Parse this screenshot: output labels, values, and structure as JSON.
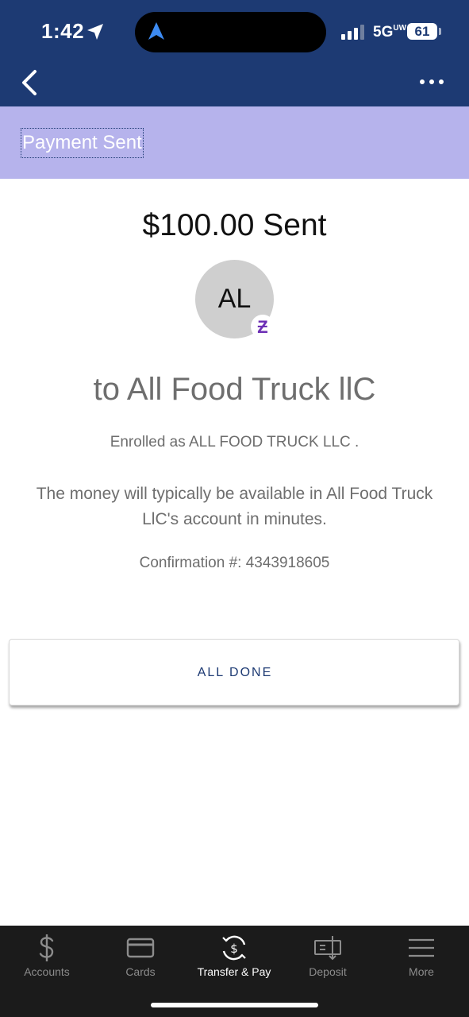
{
  "status_bar": {
    "time": "1:42",
    "network": "5G",
    "network_sub": "UW",
    "battery": "61"
  },
  "header": {
    "title": "Payment Sent"
  },
  "payment": {
    "amount_text": "$100.00 Sent",
    "avatar_initials": "AL",
    "zelle_glyph": "Ƶ",
    "recipient_line": "to All Food Truck llC",
    "enrolled_text": "Enrolled as ALL FOOD TRUCK LLC .",
    "availability_text": "The money will typically be available in All Food Truck LlC's account in minutes.",
    "confirmation_text": "Confirmation #: 4343918605"
  },
  "actions": {
    "done_label": "ALL DONE"
  },
  "tabbar": {
    "items": [
      {
        "label": "Accounts",
        "icon": "dollar-icon"
      },
      {
        "label": "Cards",
        "icon": "card-icon"
      },
      {
        "label": "Transfer & Pay",
        "icon": "transfer-icon",
        "active": true
      },
      {
        "label": "Deposit",
        "icon": "check-deposit-icon"
      },
      {
        "label": "More",
        "icon": "menu-icon"
      }
    ]
  },
  "colors": {
    "nav_blue": "#1d3a73",
    "header_lavender": "#b6b3ec",
    "zelle_purple": "#6d2fb5",
    "tabbar_bg": "#1b1b1b"
  }
}
